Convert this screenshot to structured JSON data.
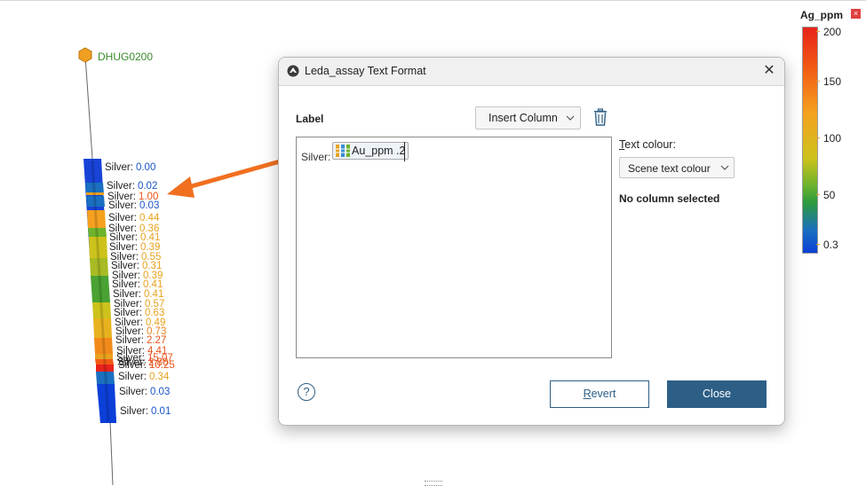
{
  "scene": {
    "hole_id": "DHUG0200",
    "annotations": [
      {
        "prefix": "Silver:",
        "value": "0.00",
        "color": "#1a55c8"
      },
      {
        "prefix": "Silver:",
        "value": "0.02",
        "color": "#1a55c8"
      },
      {
        "prefix": "Silver:",
        "value": "1.00",
        "color": "#e8531b"
      },
      {
        "prefix": "Silver:",
        "value": "0.03",
        "color": "#1a55c8"
      },
      {
        "prefix": "Silver:",
        "value": "0.44",
        "color": "#e8a21f"
      },
      {
        "prefix": "Silver:",
        "value": "0.36",
        "color": "#e8a21f"
      },
      {
        "prefix": "Silver:",
        "value": "0.41",
        "color": "#e8a21f"
      },
      {
        "prefix": "Silver:",
        "value": "0.39",
        "color": "#e8a21f"
      },
      {
        "prefix": "Silver:",
        "value": "0.55",
        "color": "#e8a21f"
      },
      {
        "prefix": "Silver:",
        "value": "0.31",
        "color": "#e8a21f"
      },
      {
        "prefix": "Silver:",
        "value": "0.39",
        "color": "#e8a21f"
      },
      {
        "prefix": "Silver:",
        "value": "0.41",
        "color": "#e8a21f"
      },
      {
        "prefix": "Silver:",
        "value": "0.41",
        "color": "#e8a21f"
      },
      {
        "prefix": "Silver:",
        "value": "0.57",
        "color": "#e8a21f"
      },
      {
        "prefix": "Silver:",
        "value": "0.63",
        "color": "#e8a21f"
      },
      {
        "prefix": "Silver:",
        "value": "0.49",
        "color": "#e8a21f"
      },
      {
        "prefix": "Silver:",
        "value": "0.73",
        "color": "#e8821f"
      },
      {
        "prefix": "Silver:",
        "value": "2.27",
        "color": "#e8531b"
      },
      {
        "prefix": "Silver:",
        "value": "4.41",
        "color": "#e8531b"
      },
      {
        "prefix": "Silver:",
        "value": "15.07",
        "color": "#e8531b"
      },
      {
        "prefix": "Silver:",
        "value": "2.80",
        "color": "#e8531b"
      },
      {
        "prefix": "Silver:",
        "value": "10.25",
        "color": "#e8531b"
      },
      {
        "prefix": "Silver:",
        "value": "0.34",
        "color": "#e8a21f"
      },
      {
        "prefix": "Silver:",
        "value": "0.03",
        "color": "#1a55c8"
      },
      {
        "prefix": "Silver:",
        "value": "0.01",
        "color": "#1a55c8"
      }
    ]
  },
  "legend": {
    "title": "Ag_ppm",
    "close_glyph": "×",
    "ticks": [
      "200",
      "150",
      "100",
      "50",
      "0.3"
    ],
    "colors": {
      "high": "#e8231b",
      "mid": "#cdc21c",
      "low": "#0b3fd8"
    }
  },
  "dialog": {
    "title": "Leda_assay Text Format",
    "close_glyph": "✕",
    "label_heading": "Label",
    "insert_column": "Insert Column",
    "editor": {
      "prefix": "Silver:",
      "chip": "Au_ppm .2"
    },
    "text_colour_label_first": "T",
    "text_colour_label_rest": "ext colour:",
    "text_colour_value": "Scene text colour",
    "no_column": "No column selected",
    "help": "?",
    "revert_first": "R",
    "revert_rest": "evert",
    "close": "Close",
    "accent_color": "#2d5f86",
    "icons": {
      "app": "app-logo-icon",
      "trash": "trash-icon",
      "chevron": "chevron-down-icon",
      "chip": "column-icon",
      "help": "help-icon"
    }
  }
}
